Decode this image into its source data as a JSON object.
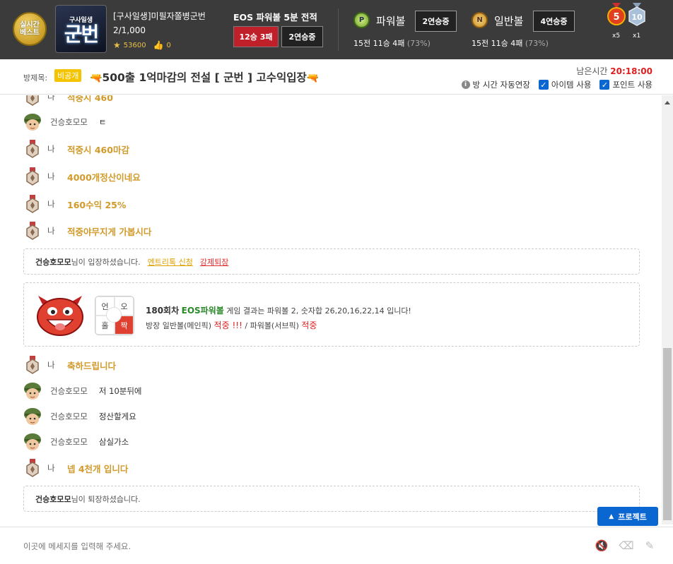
{
  "header": {
    "best_badge": "실시간\n베스트",
    "logo_top": "구사일생",
    "logo_main": "군번",
    "room_name": "[구사일생]미필자쫄병군번",
    "room_count": "2/1,000",
    "stars": "53600",
    "likes": "0",
    "record_title": "EOS 파워볼 5분 전적",
    "record_win_loss": "12승 3패",
    "record_streak": "2연승중",
    "powerball": {
      "ball_letter": "P",
      "label": "파워볼",
      "streak": "2연승중",
      "stats": "15전 11승 4패",
      "pct": "(73%)"
    },
    "normalball": {
      "ball_letter": "N",
      "label": "일반볼",
      "streak": "4연승중",
      "stats": "15전 11승 4패",
      "pct": "(73%)"
    },
    "medal_red": {
      "num": "5",
      "count": "x5"
    },
    "medal_silver": {
      "num": "10",
      "count": "x1"
    }
  },
  "titlebar": {
    "label": "방제목:",
    "private_tag": "비공개",
    "title": "500출 1억마감의 전설 [ 군번 ] 고수익입장",
    "remain_label": "남은시간",
    "remain_time": "20:18:00",
    "opt_auto": "방 시간 자동연장",
    "opt_item": "아이템 사용",
    "opt_point": "포인트 사용"
  },
  "chat": {
    "me_name": "나",
    "partial_top": "적중시 460",
    "messages": [
      {
        "who": "건승호모모",
        "text": "ㅌ"
      },
      {
        "who": "나",
        "text": "적중시 460마감"
      },
      {
        "who": "나",
        "text": "4000개정산이네요"
      },
      {
        "who": "나",
        "text": "160수익 25%"
      },
      {
        "who": "나",
        "text": "적중야무지게 가봅시다"
      }
    ],
    "enter_notice": {
      "name": "건승호모모",
      "suffix": "님이 입장하셨습니다.",
      "link1": "엔트리톡 신청",
      "link2": "강제퇴장"
    },
    "result": {
      "round": "180회차",
      "game": "EOS파워볼",
      "text1": " 게임 결과는 파워볼 2, 숫자합 26,20,16,22,14 입니다!",
      "line2_a": "방장 일반볼(메인픽) ",
      "line2_b": "적중 !!!",
      "line2_c": " / 파워볼(서브픽) ",
      "line2_d": "적중",
      "grid": [
        "언",
        "오",
        "홀",
        "짝"
      ]
    },
    "messages2": [
      {
        "who": "나",
        "text": "축하드립니다"
      },
      {
        "who": "건승호모모",
        "text": "저 10분뒤에"
      },
      {
        "who": "건승호모모",
        "text": "정산할게요"
      },
      {
        "who": "건승호모모",
        "text": "삼실가소"
      },
      {
        "who": "나",
        "text": "넵 4천개 입니다"
      }
    ],
    "leave_notice": {
      "name": "건승호모모",
      "suffix": "님이 퇴장하셨습니다."
    }
  },
  "project_button": "프로젝트",
  "input": {
    "placeholder": "이곳에 메세지를 입력해 주세요."
  }
}
